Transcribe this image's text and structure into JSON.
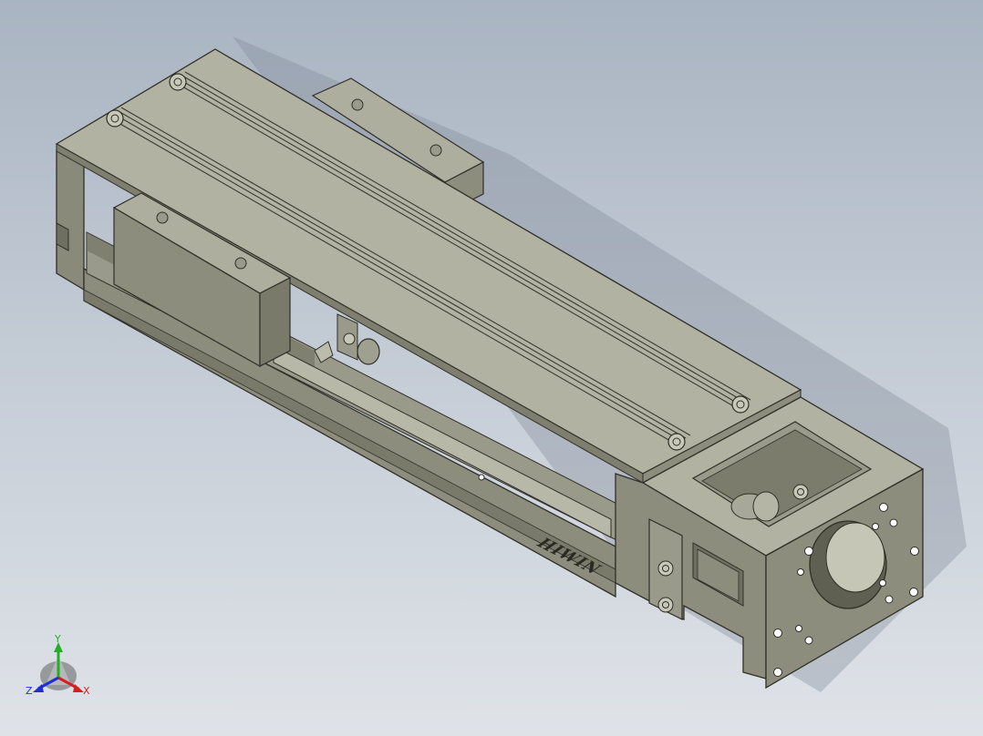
{
  "viewport": {
    "background_top": "#a9b4c2",
    "background_bottom": "#dfe3e8"
  },
  "model": {
    "part": "linear-actuator-module",
    "logo_text": "HIWIN",
    "colors": {
      "metal_top": "#aeae9e",
      "metal_front": "#8d8d7d",
      "metal_dark": "#6f6f60",
      "edge": "#2f2f28"
    }
  },
  "triad": {
    "x_label": "X",
    "y_label": "Y",
    "z_label": "Z",
    "x_color": "#d42020",
    "y_color": "#22b022",
    "z_color": "#2030d0"
  }
}
